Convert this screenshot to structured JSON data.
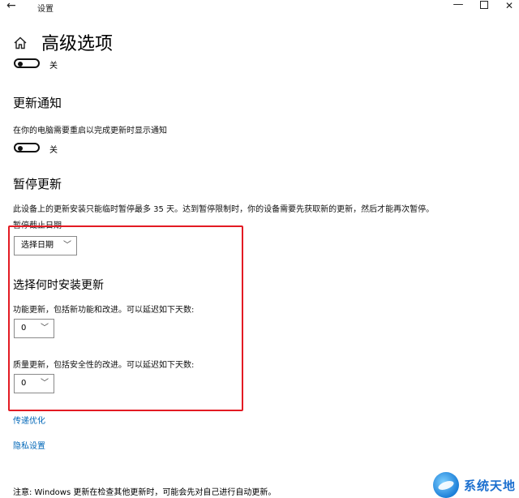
{
  "window": {
    "back_icon": "arrow-left-icon",
    "title": "设置",
    "minimize_glyph": "—",
    "close_glyph": "✕"
  },
  "header": {
    "home_icon": "home-icon",
    "title": "高级选项"
  },
  "top_toggle": {
    "state_label": "关"
  },
  "update_notification": {
    "heading": "更新通知",
    "description": "在你的电脑需要重启以完成更新时显示通知",
    "state_label": "关"
  },
  "pause_updates": {
    "heading": "暂停更新",
    "description": "此设备上的更新安装只能临时暂停最多 35 天。达到暂停限制时，你的设备需要先获取新的更新，然后才能再次暂停。",
    "field_label": "暂停截止日期",
    "dropdown_value": "选择日期"
  },
  "install_timing": {
    "heading": "选择何时安装更新",
    "feature_label": "功能更新，包括新功能和改进。可以延迟如下天数:",
    "feature_value": "0",
    "quality_label": "质量更新，包括安全性的改进。可以延迟如下天数:",
    "quality_value": "0"
  },
  "links": {
    "delivery_optimization": "传递优化",
    "privacy_settings": "隐私设置"
  },
  "footer": {
    "note": "注意: Windows 更新在检查其他更新时，可能会先对自己进行自动更新。"
  },
  "watermark": {
    "text": "系统天地"
  },
  "colors": {
    "accent_link": "#0067b8",
    "highlight_border": "#e31b23"
  }
}
